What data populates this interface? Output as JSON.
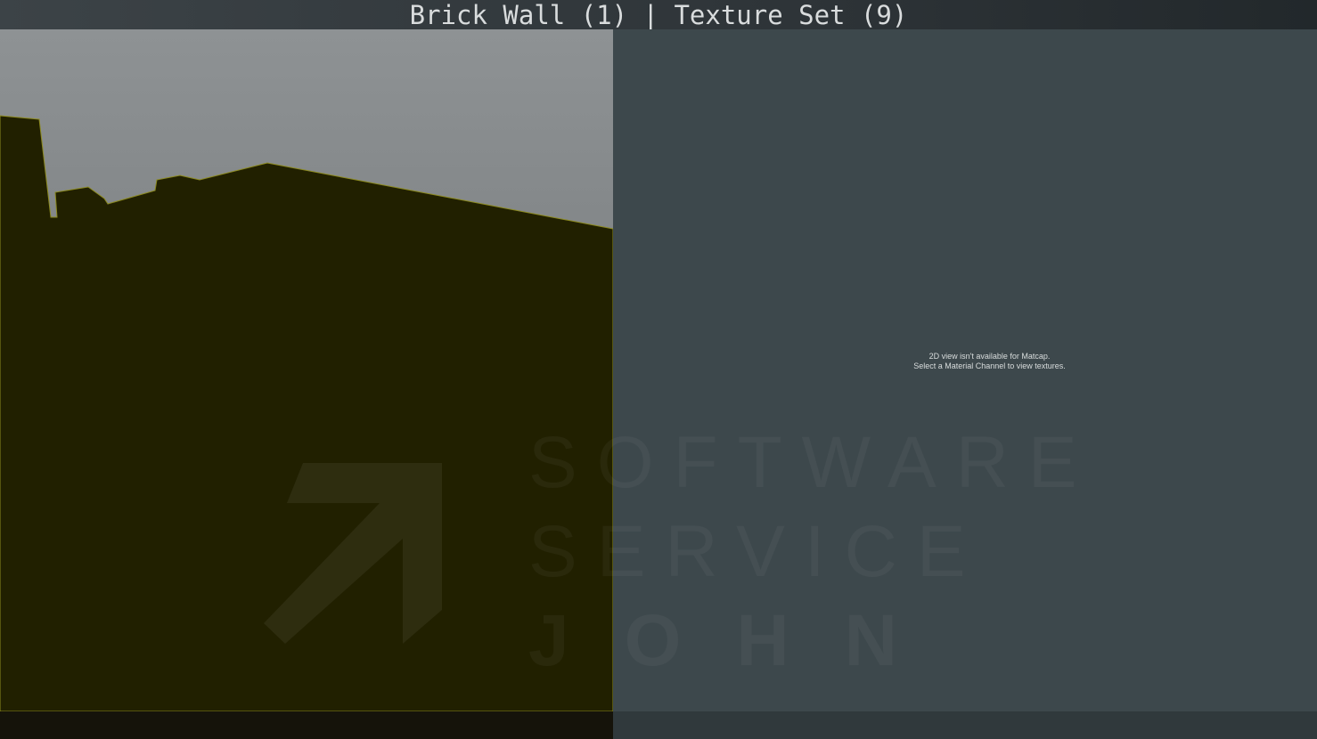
{
  "window": {
    "title": "Brick Wall (1) | Texture Set (9)"
  },
  "viewport_2d": {
    "message_line1": "2D view isn't available for Matcap.",
    "message_line2": "Select a Material Channel to view textures."
  },
  "watermark": {
    "line1": "SOFTWARE",
    "line2": "SERVICE",
    "line3": "JOHN"
  },
  "colors": {
    "model_fill": "#212000",
    "model_edge": "#8c8a1e",
    "sky_top": "#8e9294",
    "panel_2d": "#3d484c"
  }
}
